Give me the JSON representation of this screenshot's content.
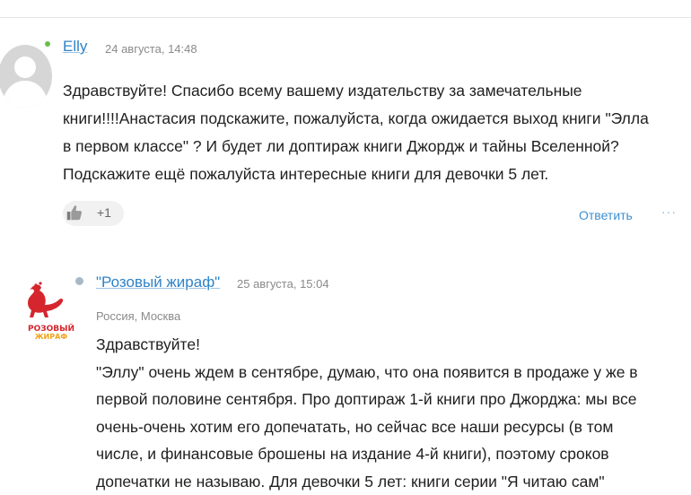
{
  "comments": [
    {
      "author": "Elly",
      "date": "24 августа, 14:48",
      "text_lines": [
        "Здравствуйте! Спасибо всему вашему издательству за замечательные",
        "книги!!!!Анастасия подскажите, пожалуйста, когда ожидается выход книги \"Элла",
        "в первом классе\" ? И будет ли доптираж книги Джордж и тайны Вселенной?",
        "Подскажите ещё пожалуйста интересные книги для девочки 5 лет."
      ],
      "likes": "+1",
      "reply_label": "Ответить",
      "more_label": "···",
      "status_color": "#6abf4b"
    },
    {
      "author": "\"Розовый жираф\"",
      "date": "25 августа, 15:04",
      "location": "Россия, Москва",
      "logo_text_line1": "РОЗОВЫЙ",
      "logo_text_line2": "ЖИРАФ",
      "text_lines": [
        "Здравствуйте!",
        "\"Эллу\" очень ждем в сентябре, думаю, что она появится в продаже у же в",
        "первой половине сентября. Про доптираж 1-й книги про Джорджа: мы все",
        "очень-очень хотим его допечатать, но сейчас все наши ресурсы (в том",
        "числе, и финансовые брошены на издание 4-й книги), поэтому сроков",
        "допечатки не называю. Для девочки 5 лет: книги серии \"Я читаю сам\""
      ],
      "status_color": "#a9b8c8"
    }
  ],
  "colors": {
    "link": "#2f82c8",
    "brand_red": "#d5262e",
    "brand_orange": "#f0a21a"
  }
}
